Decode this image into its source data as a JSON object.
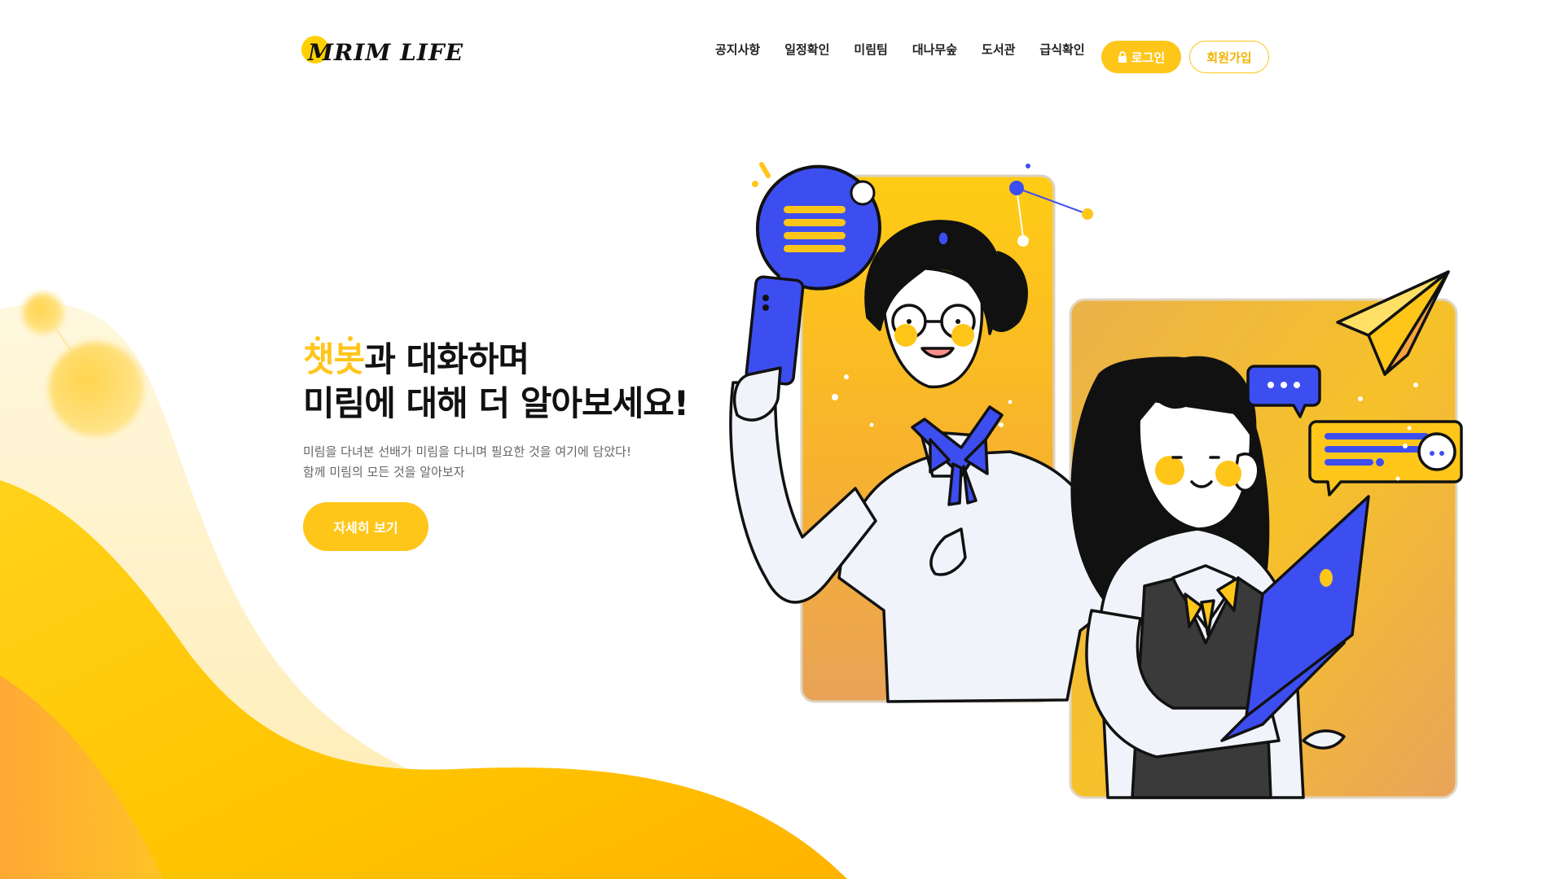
{
  "header": {
    "logo_text": "MRIM LIFE",
    "nav": [
      "공지사항",
      "일정확인",
      "미림팀",
      "대나무숲",
      "도서관",
      "급식확인"
    ],
    "login_label": "로그인",
    "signup_label": "회원가입"
  },
  "hero": {
    "title_accent": "챗봇",
    "title_line1_rest": "과 대화하며",
    "title_line2": "미림에 대해 더 알아보세요!",
    "desc_line1": "미림을 다녀본 선배가 미림을 다니며 필요한 것을 여기에 담았다!",
    "desc_line2": "함께 미림의 모든 것을 알아보자",
    "cta_label": "자세히 보기"
  },
  "colors": {
    "accent": "#ffc61a",
    "accent_dark": "#f0b400",
    "blue": "#3d4ef0",
    "orange": "#f7a23c"
  }
}
